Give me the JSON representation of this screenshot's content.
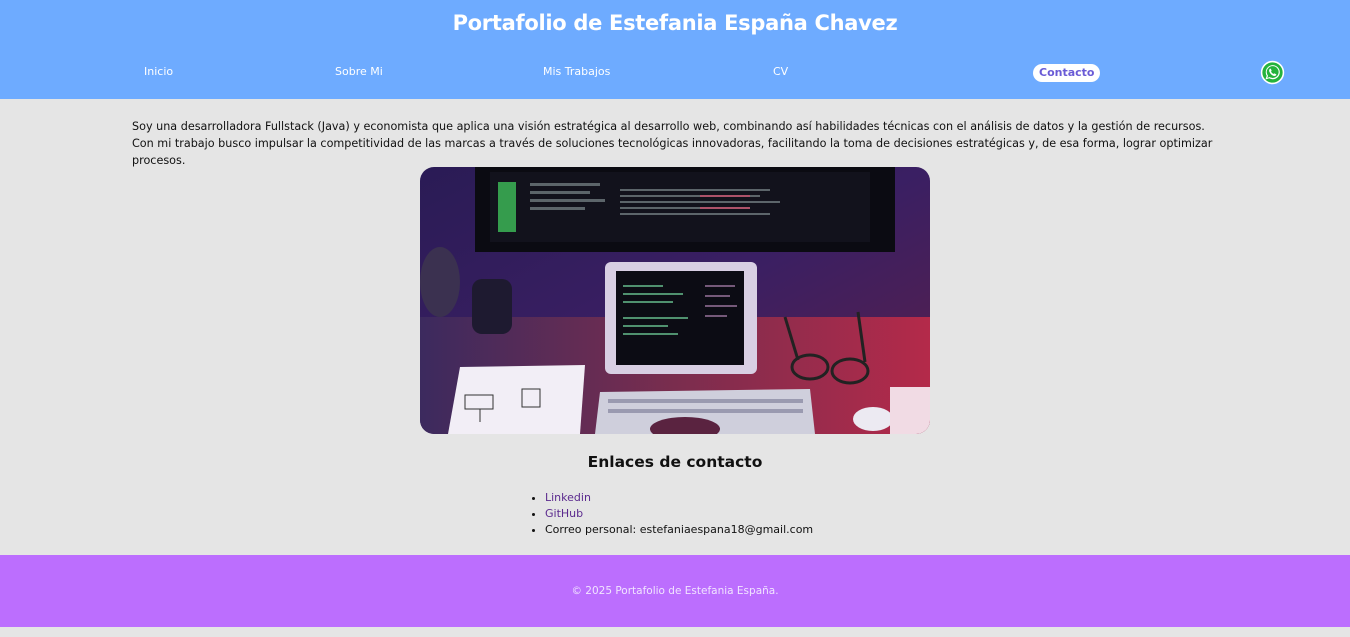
{
  "header": {
    "title": "Portafolio de Estefania España Chavez",
    "nav": [
      {
        "label": "Inicio"
      },
      {
        "label": "Sobre Mi"
      },
      {
        "label": "Mis Trabajos"
      },
      {
        "label": "CV"
      },
      {
        "label": "Contacto",
        "active": true
      }
    ],
    "whatsapp_icon": "whatsapp-icon"
  },
  "main": {
    "intro": "Soy una desarrolladora Fullstack (Java) y economista que aplica una visión estratégica al desarrollo web, combinando así habilidades técnicas con el análisis de datos y la gestión de recursos. Con mi trabajo busco impulsar la competitividad de las marcas a través de soluciones tecnológicas innovadoras, facilitando la toma de decisiones estratégicas y, de esa forma, lograr optimizar procesos.",
    "contact_heading": "Enlaces de contacto",
    "contacts": [
      {
        "label": "Linkedin"
      },
      {
        "label": "GitHub"
      },
      {
        "label": "Correo personal: estefaniaespana18@gmail.com"
      }
    ]
  },
  "footer": {
    "copyright": "© 2025 Portafolio de Estefania España."
  },
  "colors": {
    "header_bg": "#6eabff",
    "footer_bg": "#bc6efe",
    "page_bg": "#e5e5e5",
    "link": "#5b2a8e",
    "active_nav_text": "#6a5bd6"
  }
}
